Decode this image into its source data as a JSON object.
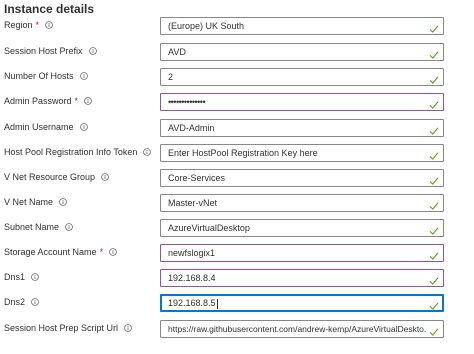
{
  "section": {
    "title": "Instance details"
  },
  "fields": [
    {
      "label": "Region",
      "required": true,
      "value": "(Europe) UK South"
    },
    {
      "label": "Session Host Prefix",
      "required": false,
      "value": "AVD"
    },
    {
      "label": "Number Of Hosts",
      "required": false,
      "value": "2"
    },
    {
      "label": "Admin Password",
      "required": true,
      "value": "••••••••••••••"
    },
    {
      "label": "Admin Username",
      "required": false,
      "value": "AVD-Admin"
    },
    {
      "label": "Host Pool Registration Info Token",
      "required": false,
      "value": "Enter HostPool Registration Key here"
    },
    {
      "label": "V Net Resource Group",
      "required": false,
      "value": "Core-Services"
    },
    {
      "label": "V Net Name",
      "required": false,
      "value": "Master-vNet"
    },
    {
      "label": "Subnet Name",
      "required": false,
      "value": "AzureVirtualDesktop"
    },
    {
      "label": "Storage Account Name",
      "required": true,
      "value": "newfslogix1"
    },
    {
      "label": "Dns1",
      "required": false,
      "value": "192.168.8.4"
    },
    {
      "label": "Dns2",
      "required": false,
      "value": "192.168.8.5"
    },
    {
      "label": "Session Host Prep Script Url",
      "required": false,
      "value": "https://raw.githubusercontent.com/andrew-kemp/AzureVirtualDeskto..."
    }
  ],
  "required_marker": "*",
  "colors": {
    "check": "#57a300",
    "required": "#a4262c",
    "focus": "#0078d4",
    "modified": "#8f54a7",
    "border": "#8a8886"
  },
  "icons": {
    "info": "info-icon",
    "valid": "checkmark-icon"
  }
}
